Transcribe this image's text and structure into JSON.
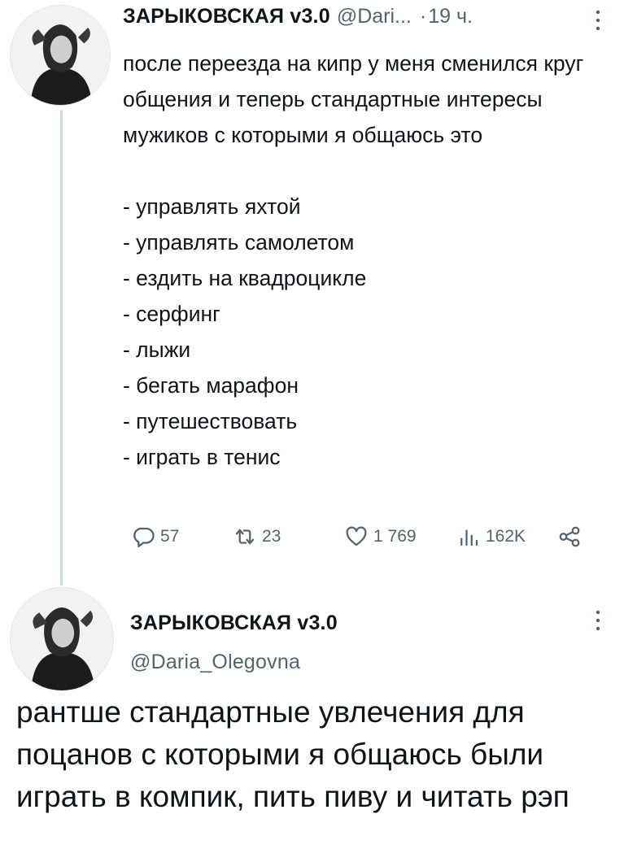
{
  "tweet1": {
    "display_name": "ЗАРЫКОВСКАЯ v3.0",
    "handle": "@Dari...",
    "dot": "·",
    "time": "19 ч.",
    "text": "после переезда на кипр у меня сменился круг общения и теперь стандартные интересы мужиков с которыми я общаюсь это\n\n- управлять яхтой\n- управлять самолетом\n- ездить на квадроцикле\n- серфинг\n- лыжи\n- бегать марафон\n- путешествовать\n- играть в тенис",
    "replies": "57",
    "reposts": "23",
    "likes": "1 769",
    "views": "162K",
    "icons": [
      "more-icon",
      "reply-icon",
      "repost-icon",
      "like-icon",
      "views-icon",
      "share-icon"
    ]
  },
  "tweet2": {
    "display_name": "ЗАРЫКОВСКАЯ v3.0",
    "handle": "@Daria_Olegovna",
    "text": "рантше стандартные увлечения для поцанов с которыми я общаюсь были играть в компик, пить пиву и читать рэп"
  },
  "colors": {
    "text": "#0f1419",
    "muted": "#536471",
    "thread_line": "#cfd9de"
  }
}
